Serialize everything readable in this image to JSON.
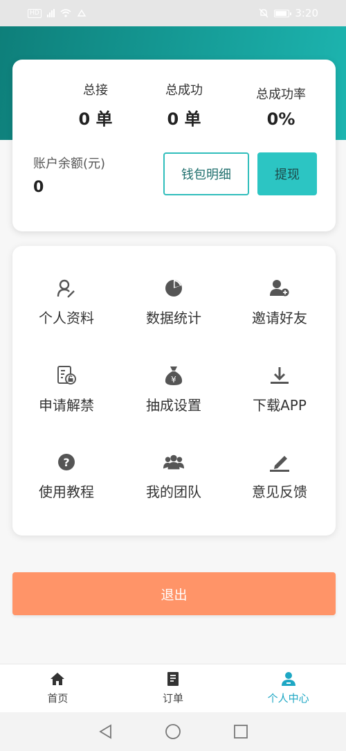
{
  "status_bar": {
    "hd_badge": "HD",
    "time": "3:20"
  },
  "stats": {
    "total_orders": {
      "label": "总接",
      "value": "0 单"
    },
    "total_success": {
      "label": "总成功",
      "value": "0 单"
    },
    "success_rate": {
      "label": "总成功率",
      "value": "0%"
    }
  },
  "balance": {
    "label": "账户余额(元)",
    "value": "0"
  },
  "buttons": {
    "wallet_detail": "钱包明细",
    "withdraw": "提现",
    "logout": "退出"
  },
  "menu": {
    "items": [
      {
        "label": "个人资料",
        "icon": "profile-edit-icon"
      },
      {
        "label": "数据统计",
        "icon": "pie-chart-icon"
      },
      {
        "label": "邀请好友",
        "icon": "add-user-icon"
      },
      {
        "label": "申请解禁",
        "icon": "unlock-document-icon"
      },
      {
        "label": "抽成设置",
        "icon": "money-bag-icon"
      },
      {
        "label": "下载APP",
        "icon": "download-icon"
      },
      {
        "label": "使用教程",
        "icon": "help-icon"
      },
      {
        "label": "我的团队",
        "icon": "team-icon"
      },
      {
        "label": "意见反馈",
        "icon": "feedback-pen-icon"
      }
    ]
  },
  "tabs": [
    {
      "label": "首页",
      "icon": "home-icon",
      "active": false
    },
    {
      "label": "订单",
      "icon": "order-icon",
      "active": false
    },
    {
      "label": "个人中心",
      "icon": "user-center-icon",
      "active": true
    }
  ],
  "colors": {
    "header_start": "#0e7f7a",
    "header_end": "#1db5b0",
    "accent": "#2cc5c3",
    "logout": "#ff9468",
    "tab_active": "#1da7c4"
  }
}
